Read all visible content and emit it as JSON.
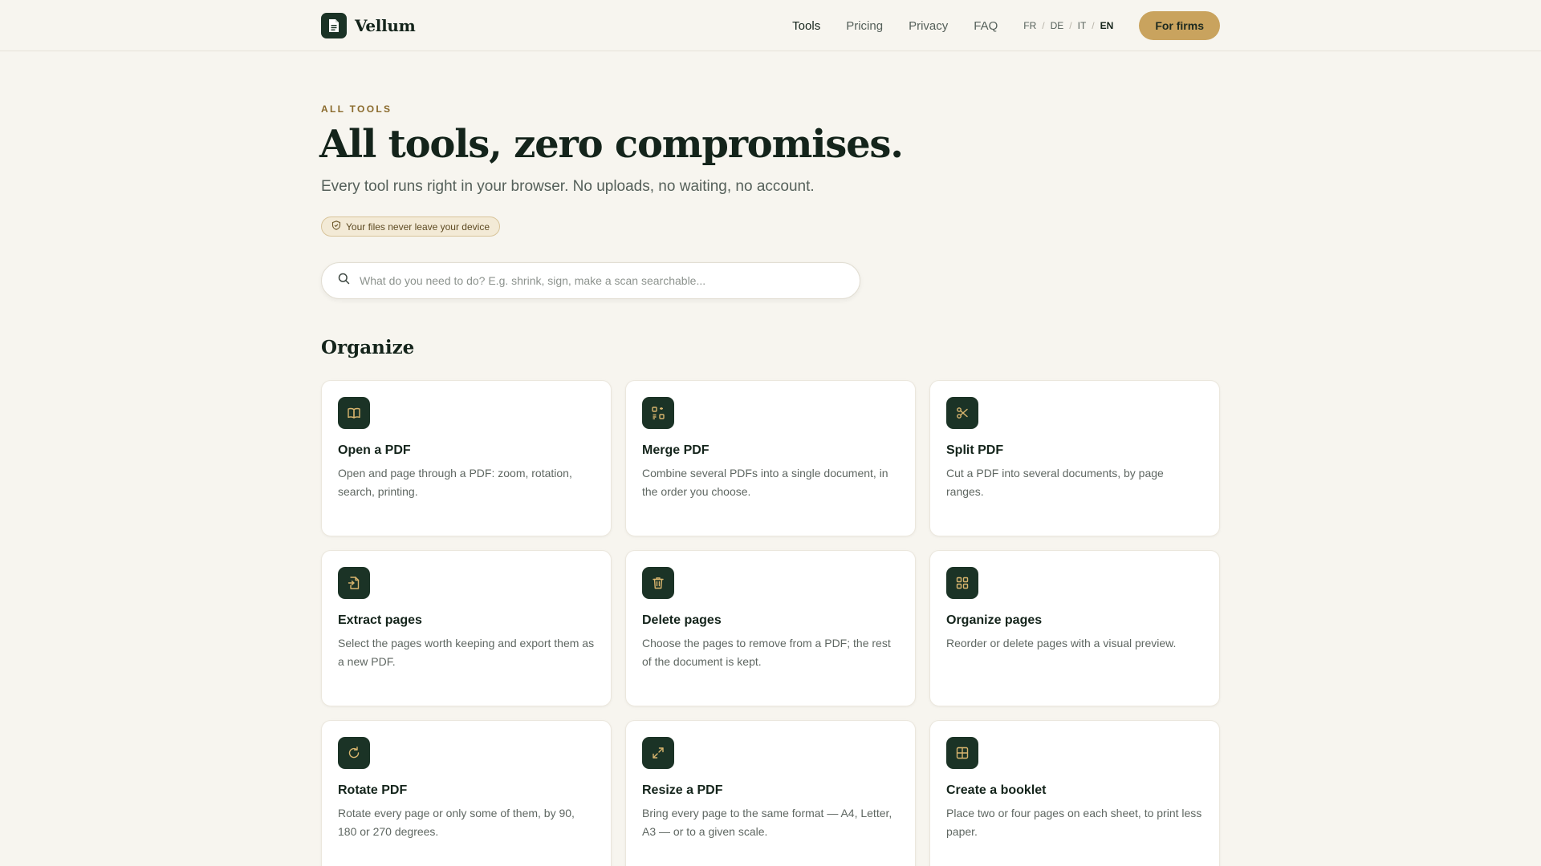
{
  "brand": {
    "name": "Vellum",
    "logo_icon": "document-icon"
  },
  "nav": {
    "links": [
      {
        "label": "Tools",
        "active": true
      },
      {
        "label": "Pricing",
        "active": false
      },
      {
        "label": "Privacy",
        "active": false
      },
      {
        "label": "FAQ",
        "active": false
      }
    ],
    "languages": [
      "FR",
      "DE",
      "IT",
      "EN"
    ],
    "current_language": "EN",
    "cta_label": "For firms"
  },
  "hero": {
    "eyebrow": "ALL TOOLS",
    "title": "All tools, zero compromises.",
    "subtitle": "Every tool runs right in your browser. No uploads, no waiting, no account.",
    "privacy_badge": "Your files never leave your device"
  },
  "search": {
    "placeholder": "What do you need to do? E.g. shrink, sign, make a scan searchable...",
    "value": ""
  },
  "section": {
    "title": "Organize"
  },
  "tools": [
    {
      "title": "Open a PDF",
      "description": "Open and page through a PDF: zoom, rotation, search, printing.",
      "icon": "book-open-icon"
    },
    {
      "title": "Merge PDF",
      "description": "Combine several PDFs into a single document, in the order you choose.",
      "icon": "merge-icon"
    },
    {
      "title": "Split PDF",
      "description": "Cut a PDF into several documents, by page ranges.",
      "icon": "scissors-icon"
    },
    {
      "title": "Extract pages",
      "description": "Select the pages worth keeping and export them as a new PDF.",
      "icon": "file-export-icon"
    },
    {
      "title": "Delete pages",
      "description": "Choose the pages to remove from a PDF; the rest of the document is kept.",
      "icon": "trash-icon"
    },
    {
      "title": "Organize pages",
      "description": "Reorder or delete pages with a visual preview.",
      "icon": "grid-icon"
    },
    {
      "title": "Rotate PDF",
      "description": "Rotate every page or only some of them, by 90, 180 or 270 degrees.",
      "icon": "rotate-icon"
    },
    {
      "title": "Resize a PDF",
      "description": "Bring every page to the same format — A4, Letter, A3 — or to a given scale.",
      "icon": "expand-icon"
    },
    {
      "title": "Create a booklet",
      "description": "Place two or four pages on each sheet, to print less paper.",
      "icon": "booklet-icon"
    }
  ],
  "colors": {
    "background": "#f7f5ef",
    "primary_dark": "#1b3326",
    "accent_gold": "#c9a35e",
    "icon_gold": "#d9b56e"
  }
}
